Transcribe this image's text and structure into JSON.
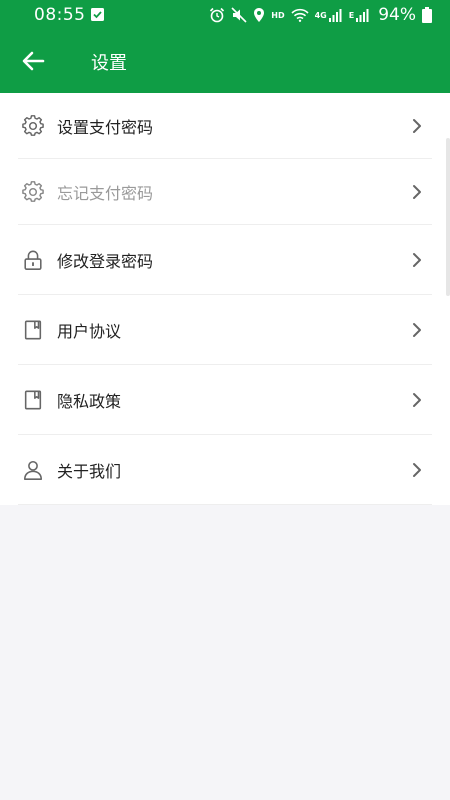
{
  "status_bar": {
    "time": "08:55",
    "network_4g": "4G",
    "hd_label": "HD",
    "network_e": "E",
    "battery_text": "94%"
  },
  "app_bar": {
    "title": "设置"
  },
  "settings": {
    "items": [
      {
        "label": "设置支付密码",
        "icon": "gear-icon",
        "enabled": true
      },
      {
        "label": "忘记支付密码",
        "icon": "gear-icon",
        "enabled": false
      },
      {
        "label": "修改登录密码",
        "icon": "lock-icon",
        "enabled": true
      },
      {
        "label": "用户协议",
        "icon": "document-icon",
        "enabled": true
      },
      {
        "label": "隐私政策",
        "icon": "document-icon",
        "enabled": true
      },
      {
        "label": "关于我们",
        "icon": "user-icon",
        "enabled": true
      }
    ]
  },
  "colors": {
    "primary": "#0f9d45",
    "background": "#f5f5f8",
    "row_background": "#ffffff",
    "text": "#222222",
    "disabled_text": "#9a9a9a"
  }
}
